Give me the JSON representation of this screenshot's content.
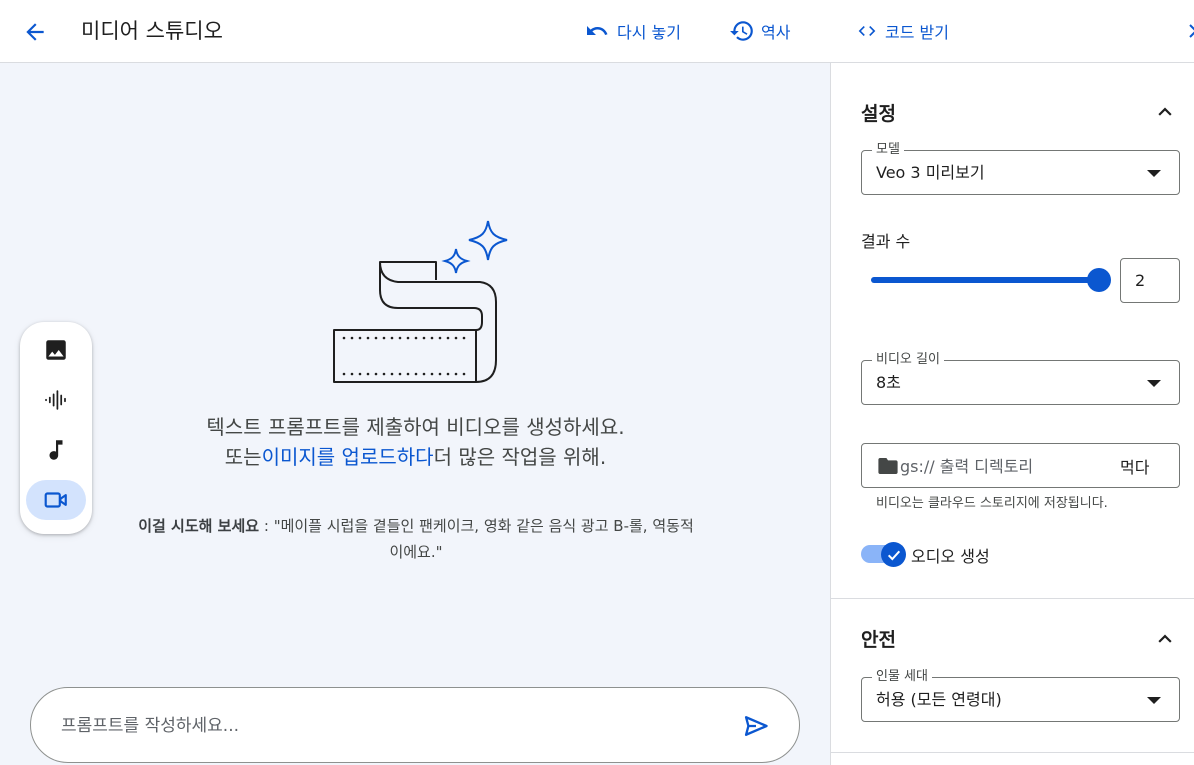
{
  "header": {
    "title": "미디어 스튜디오",
    "replay_label": "다시 놓기",
    "history_label": "역사"
  },
  "mode_bar": {
    "items": [
      {
        "name": "image",
        "icon": "image-icon",
        "active": false
      },
      {
        "name": "audio",
        "icon": "audio-waveform-icon",
        "active": false
      },
      {
        "name": "music",
        "icon": "music-note-icon",
        "active": false
      },
      {
        "name": "video",
        "icon": "videocam-icon",
        "active": true
      }
    ]
  },
  "empty_state": {
    "line1": "텍스트 프롬프트를 제출하여 비디오를 생성하세요.",
    "line2_prefix": "또는",
    "upload_link": "이미지를 업로드하다",
    "line2_suffix": "더 많은 작업을 위해.",
    "try_label": "이걸 시도해 보세요",
    "try_separator": " : ",
    "try_example": "\"메이플 시럽을 곁들인 팬케이크, 영화 같은 음식 광고 B-롤, 역동적이에요.\""
  },
  "prompt": {
    "placeholder": "프롬프트를 작성하세요..."
  },
  "panel": {
    "get_code_label": "코드 받기",
    "settings": {
      "title": "설정",
      "model": {
        "label": "모델",
        "value": "Veo 3 미리보기"
      },
      "result_count": {
        "label": "결과 수",
        "value": "2",
        "slider_fraction": 1.0
      },
      "video_length": {
        "label": "비디오 길이",
        "value": "8초"
      },
      "storage": {
        "placeholder": "gs:// 출력 디렉토리",
        "browse_label": "먹다",
        "hint": "비디오는 클라우드 스토리지에 저장됩니다."
      },
      "audio": {
        "label": "오디오 생성",
        "enabled": true
      }
    },
    "safety": {
      "title": "안전",
      "person_generation": {
        "label": "인물 세대",
        "value": "허용 (모든 연령대)"
      }
    }
  },
  "colors": {
    "accent": "#0b57d0",
    "canvas_bg": "#f2f5fb",
    "active_mode_bg": "#d3e3fd"
  }
}
